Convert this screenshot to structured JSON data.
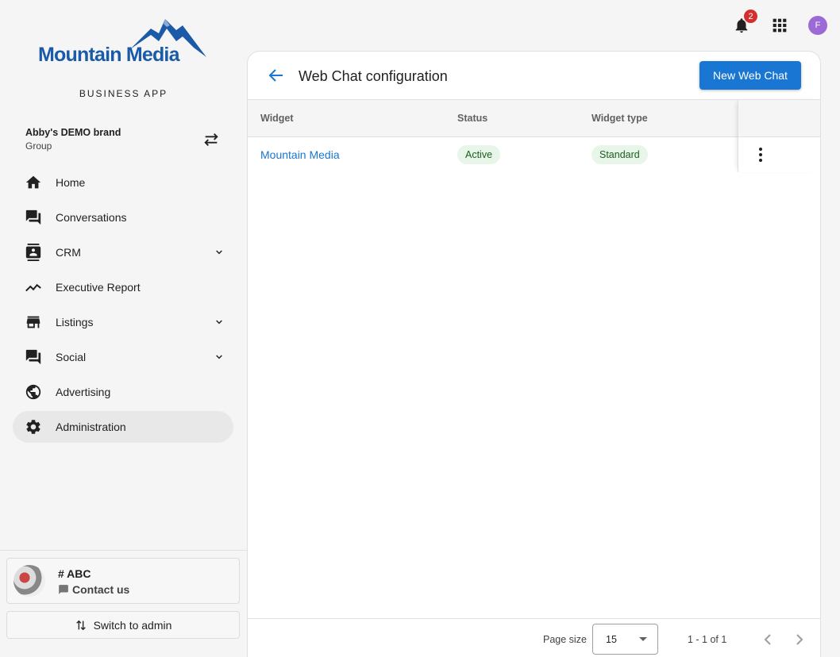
{
  "brand_logo": {
    "text": "Mountain Media",
    "color": "#1a5aa6"
  },
  "app_subtitle": "BUSINESS APP",
  "account": {
    "name": "Abby's DEMO brand",
    "type": "Group"
  },
  "nav": [
    {
      "label": "Home",
      "icon": "home-icon",
      "expandable": false
    },
    {
      "label": "Conversations",
      "icon": "forum-icon",
      "expandable": true
    },
    {
      "label": "CRM",
      "icon": "contact-card-icon",
      "expandable": true
    },
    {
      "label": "Executive Report",
      "icon": "trending-icon",
      "expandable": false
    },
    {
      "label": "Listings",
      "icon": "storefront-icon",
      "expandable": true
    },
    {
      "label": "Social",
      "icon": "forum-icon",
      "expandable": true
    },
    {
      "label": "Advertising",
      "icon": "globe-icon",
      "expandable": false
    },
    {
      "label": "Administration",
      "icon": "gear-icon",
      "expandable": false,
      "active": true
    }
  ],
  "contact": {
    "title": "# ABC",
    "link": "Contact us"
  },
  "switch_label": "Switch to admin",
  "topbar": {
    "notification_count": "2",
    "user_initial": "F"
  },
  "page": {
    "title": "Web Chat configuration",
    "new_button": "New Web Chat"
  },
  "table": {
    "columns": [
      "Widget",
      "Status",
      "Widget type"
    ],
    "rows": [
      {
        "widget": "Mountain Media",
        "status": "Active",
        "type": "Standard"
      }
    ]
  },
  "pagination": {
    "page_size_label": "Page size",
    "page_size": "15",
    "range": "1 - 1 of 1"
  },
  "colors": {
    "primary": "#1976d2",
    "chip_bg": "#e8f5e9",
    "chip_text": "#1b5e20",
    "badge": "#d32f2f",
    "avatar": "#9c6ad6"
  }
}
